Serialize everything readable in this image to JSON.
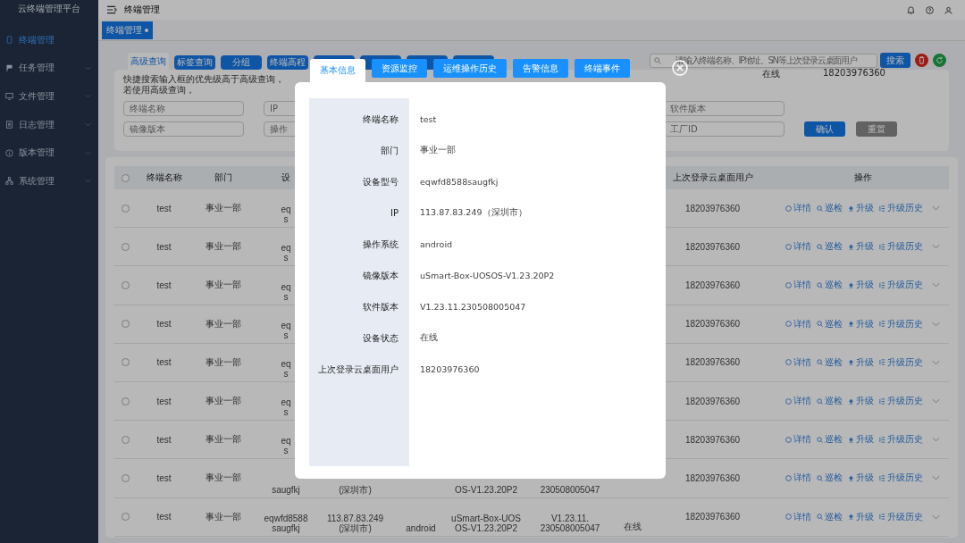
{
  "sidebar": {
    "title": "云终端管理平台",
    "items": [
      {
        "label": "终端管理",
        "selected": true,
        "expandable": false
      },
      {
        "label": "任务管理",
        "selected": false,
        "expandable": true
      },
      {
        "label": "文件管理",
        "selected": false,
        "expandable": true
      },
      {
        "label": "日志管理",
        "selected": false,
        "expandable": true
      },
      {
        "label": "版本管理",
        "selected": false,
        "expandable": true
      },
      {
        "label": "系统管理",
        "selected": false,
        "expandable": true
      }
    ]
  },
  "header": {
    "title": "终端管理"
  },
  "open_tabs": [
    {
      "label": "终端管理",
      "selected": true
    }
  ],
  "query_tabs": [
    {
      "label": "高级查询",
      "selected": true
    },
    {
      "label": "标签查询",
      "selected": false
    },
    {
      "label": "分组",
      "selected": false
    },
    {
      "label": "终端高程",
      "selected": false
    },
    {
      "selected": false
    },
    {
      "selected": false
    },
    {
      "selected": false
    },
    {
      "selected": false
    }
  ],
  "search": {
    "placeholder": "请输入终端名称、IP地址、SN等上次登录云桌面用户",
    "button": "搜索"
  },
  "stray_texts": [
    "在线",
    "18203976360"
  ],
  "filter": {
    "hint": "快捷搜索输入框的优先级高于高级查询，若使用高级查询，",
    "rows": [
      [
        {
          "placeholder": "终端名称"
        },
        {
          "placeholder": "IP"
        },
        {
          "placeholder": "软件版本"
        }
      ],
      [
        {
          "placeholder": "镜像版本"
        },
        {
          "placeholder": "操作"
        },
        {
          "placeholder": "工厂ID"
        }
      ]
    ],
    "confirm": "确认",
    "reset": "重置"
  },
  "table": {
    "select_all": {
      "checked": false
    },
    "columns": [
      "终端名称",
      "部门",
      "设",
      "",
      "",
      "",
      "",
      "",
      "上次登录云桌面用户",
      "操作"
    ],
    "rows": [
      {
        "checked": false,
        "name": "test",
        "dept": "事业一部",
        "device": [
          "eq",
          "s"
        ],
        "user": "18203976360",
        "actions": [
          "详情",
          "巡检",
          "升级",
          "升级历史"
        ]
      },
      {
        "checked": false,
        "name": "test",
        "dept": "事业一部",
        "device": [
          "eq",
          "s"
        ],
        "user": "18203976360",
        "actions": [
          "详情",
          "巡检",
          "升级",
          "升级历史"
        ]
      },
      {
        "checked": false,
        "name": "test",
        "dept": "事业一部",
        "device": [
          "eq",
          "s"
        ],
        "user": "18203976360",
        "actions": [
          "详情",
          "巡检",
          "升级",
          "升级历史"
        ]
      },
      {
        "checked": false,
        "name": "test",
        "dept": "事业一部",
        "device": [
          "eq",
          "s"
        ],
        "user": "18203976360",
        "actions": [
          "详情",
          "巡检",
          "升级",
          "升级历史"
        ]
      },
      {
        "checked": false,
        "name": "test",
        "dept": "事业一部",
        "device": [
          "eq",
          "s"
        ],
        "user": "18203976360",
        "actions": [
          "详情",
          "巡检",
          "升级",
          "升级历史"
        ]
      },
      {
        "checked": false,
        "name": "test",
        "dept": "事业一部",
        "device": [
          "eq",
          "s"
        ],
        "user": "18203976360",
        "actions": [
          "详情",
          "巡检",
          "升级",
          "升级历史"
        ]
      },
      {
        "checked": false,
        "name": "test",
        "dept": "事业一部",
        "device": [
          "eq",
          "s"
        ],
        "user": "18203976360",
        "actions": [
          "详情",
          "巡检",
          "升级",
          "升级历史"
        ]
      },
      {
        "checked": false,
        "name": "test",
        "dept": "事业一部",
        "device": [
          "saugfkj"
        ],
        "ip": [
          "(深圳市)"
        ],
        "image": [
          "OS-V1.23.20P2"
        ],
        "software": [
          "230508005047"
        ],
        "user": "18203976360",
        "actions": [
          "详情",
          "巡检",
          "升级",
          "升级历史"
        ]
      },
      {
        "checked": false,
        "name": "test",
        "dept": "事业一部",
        "device": [
          "eqwfd8588",
          "saugfkj"
        ],
        "ip": [
          "113.87.83.249",
          "(深圳市)"
        ],
        "os": "android",
        "image": [
          "uSmart-Box-UOS",
          "OS-V1.23.20P2"
        ],
        "software": [
          "V1.23.11.",
          "230508005047"
        ],
        "status": "在线",
        "user": "18203976360",
        "actions": [
          "详情",
          "巡检",
          "升级",
          "升级历史"
        ]
      }
    ]
  },
  "dialog": {
    "tabs": [
      {
        "label": "基本信息",
        "selected": true
      },
      {
        "label": "资源监控",
        "selected": false
      },
      {
        "label": "运维操作历史",
        "selected": false
      },
      {
        "label": "告警信息",
        "selected": false
      },
      {
        "label": "终端事件",
        "selected": false
      }
    ],
    "fields": [
      {
        "label": "终端名称",
        "value": "test"
      },
      {
        "label": "部门",
        "value": "事业一部"
      },
      {
        "label": "设备型号",
        "value": "eqwfd8588saugfkj"
      },
      {
        "label": "IP",
        "value": "113.87.83.249（深圳市）"
      },
      {
        "label": "操作系统",
        "value": "android"
      },
      {
        "label": "镜像版本",
        "value": "uSmart-Box-UOSOS-V1.23.20P2"
      },
      {
        "label": "软件版本",
        "value": "V1.23.11.230508005047"
      },
      {
        "label": "设备状态",
        "value": "在线"
      },
      {
        "label": "上次登录云桌面用户",
        "value": "18203976360"
      }
    ]
  }
}
